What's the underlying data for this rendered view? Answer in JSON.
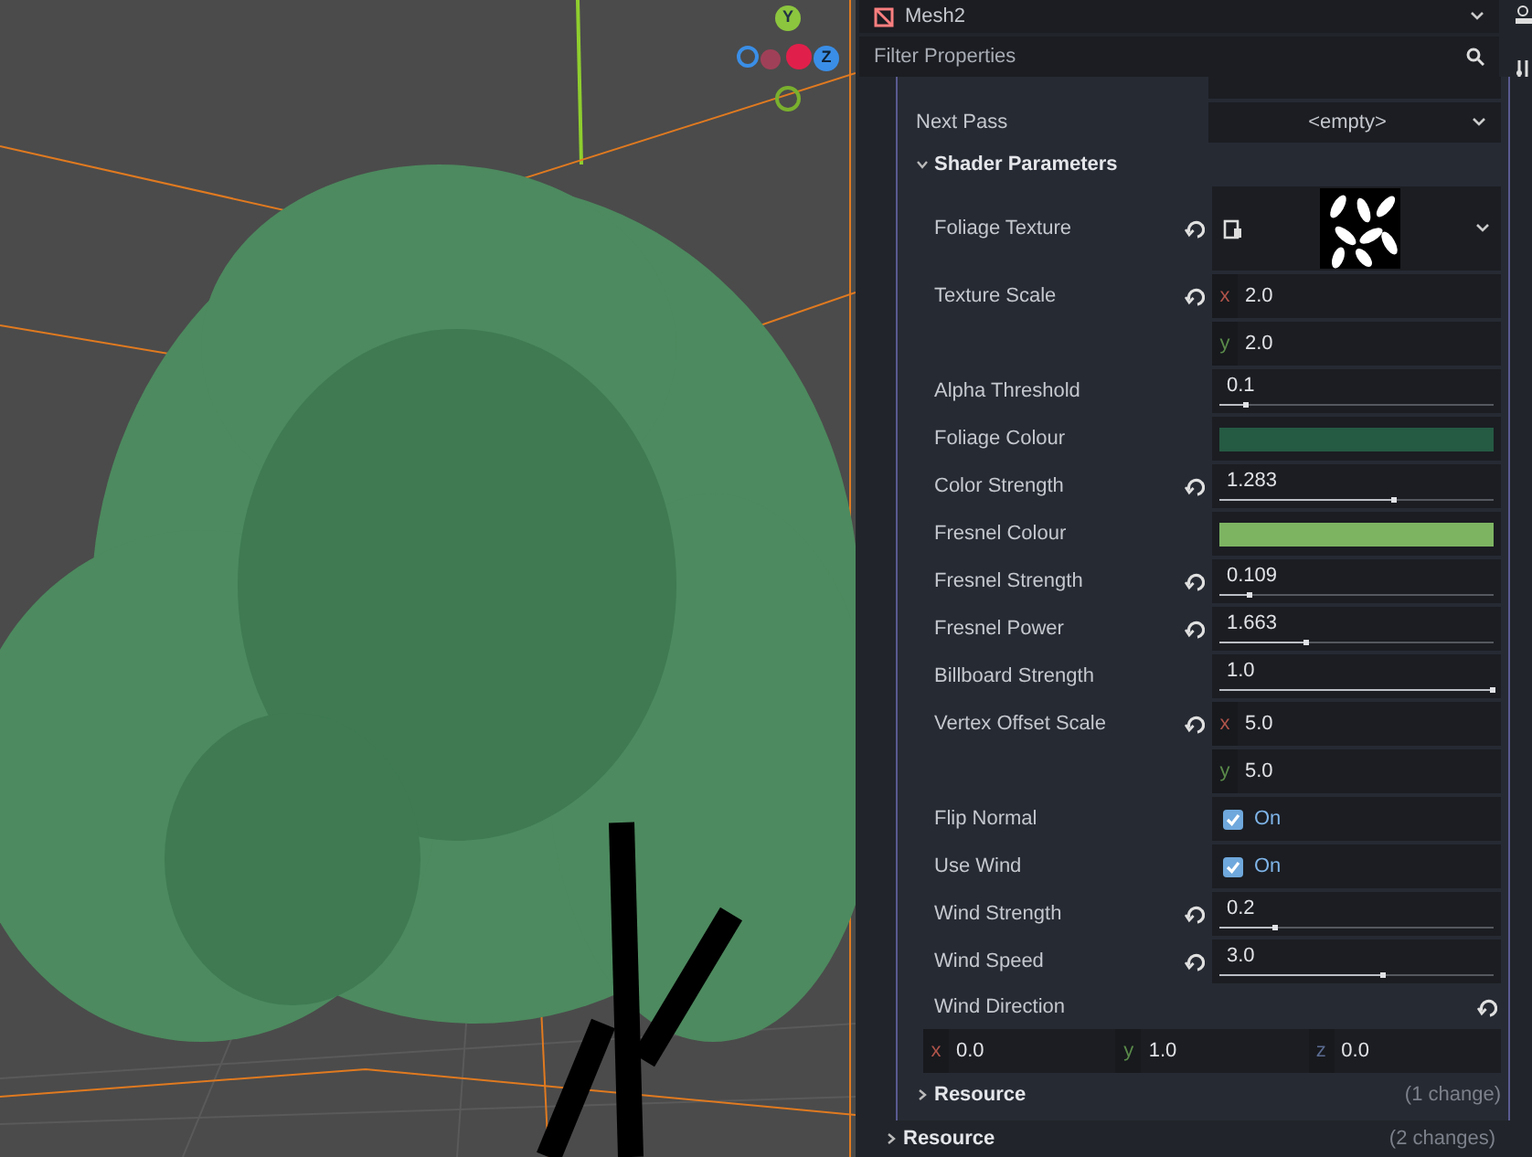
{
  "viewport": {
    "gizmo": [
      {
        "label": "Y"
      },
      {
        "label": "Z"
      }
    ]
  },
  "inspector": {
    "node_name": "Mesh2",
    "filter": {
      "placeholder": "Filter Properties"
    },
    "next_pass": {
      "label": "Next Pass",
      "value": "<empty>"
    },
    "section": {
      "title": "Shader Parameters",
      "expanded": true
    },
    "params": [
      {
        "kind": "texture",
        "label": "Foliage Texture",
        "revert": true
      },
      {
        "kind": "vector2",
        "label": "Texture Scale",
        "revert": true,
        "components": [
          {
            "axis": "x",
            "value": "2.0"
          },
          {
            "axis": "y",
            "value": "2.0"
          }
        ]
      },
      {
        "kind": "slider",
        "label": "Alpha Threshold",
        "revert": false,
        "value": "0.1",
        "level": 0.1
      },
      {
        "kind": "color",
        "label": "Foliage Colour",
        "revert": false,
        "color": "#255a43"
      },
      {
        "kind": "slider",
        "label": "Color Strength",
        "revert": true,
        "value": "1.283",
        "level": 0.64
      },
      {
        "kind": "color",
        "label": "Fresnel Colour",
        "revert": false,
        "color": "#7db462"
      },
      {
        "kind": "slider",
        "label": "Fresnel Strength",
        "revert": true,
        "value": "0.109",
        "level": 0.11
      },
      {
        "kind": "slider",
        "label": "Fresnel Power",
        "revert": true,
        "value": "1.663",
        "level": 0.32
      },
      {
        "kind": "slider",
        "label": "Billboard Strength",
        "revert": false,
        "value": "1.0",
        "level": 1.0
      },
      {
        "kind": "vector2",
        "label": "Vertex Offset Scale",
        "revert": true,
        "components": [
          {
            "axis": "x",
            "value": "5.0"
          },
          {
            "axis": "y",
            "value": "5.0"
          }
        ]
      },
      {
        "kind": "checkbox",
        "label": "Flip Normal",
        "revert": false,
        "checked": true,
        "text": "On"
      },
      {
        "kind": "checkbox",
        "label": "Use Wind",
        "revert": false,
        "checked": true,
        "text": "On"
      },
      {
        "kind": "slider",
        "label": "Wind Strength",
        "revert": true,
        "value": "0.2",
        "level": 0.21
      },
      {
        "kind": "slider",
        "label": "Wind Speed",
        "revert": true,
        "value": "3.0",
        "level": 0.6
      },
      {
        "kind": "vector3",
        "label": "Wind Direction",
        "revert": true,
        "components": [
          {
            "axis": "x",
            "value": "0.0"
          },
          {
            "axis": "y",
            "value": "1.0"
          },
          {
            "axis": "z",
            "value": "0.0"
          }
        ]
      }
    ],
    "subsections": [
      {
        "title": "Resource",
        "changes": "(1 change)",
        "expanded": false
      }
    ],
    "sections_after": [
      {
        "title": "Resource",
        "changes": "(2 changes)",
        "expanded": false
      }
    ]
  }
}
